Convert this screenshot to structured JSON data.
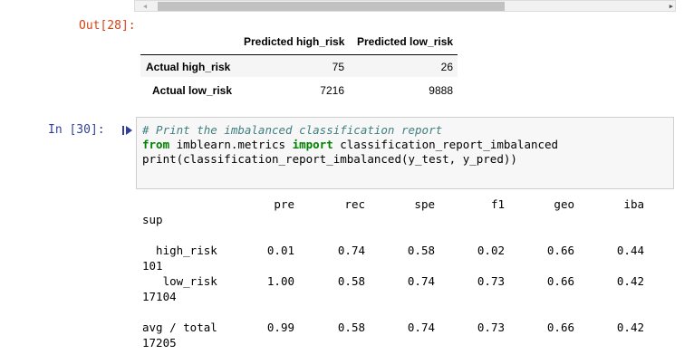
{
  "scrollbar": {
    "left_arrow": "◀",
    "right_arrow": "▶"
  },
  "out_prompt": "Out[28]:",
  "dataframe": {
    "columns": [
      "Predicted high_risk",
      "Predicted low_risk"
    ],
    "rows": [
      {
        "label": "Actual high_risk",
        "values": [
          "75",
          "26"
        ]
      },
      {
        "label": "Actual low_risk",
        "values": [
          "7216",
          "9888"
        ]
      }
    ]
  },
  "in_prompt": "In [30]:",
  "code": {
    "comment": "# Print the imbalanced classification report",
    "kw_from": "from",
    "module": " imblearn.metrics ",
    "kw_import": "import",
    "name": " classification_report_imbalanced",
    "line3": "print(classification_report_imbalanced(y_test, y_pred))"
  },
  "report": {
    "headers": [
      "pre",
      "rec",
      "spe",
      "f1",
      "geo",
      "iba"
    ],
    "sup": "sup",
    "rows": [
      {
        "label": "  high_risk",
        "values": [
          "0.01",
          "0.74",
          "0.58",
          "0.02",
          "0.66",
          "0.44"
        ],
        "support": "101"
      },
      {
        "label": "   low_risk",
        "values": [
          "1.00",
          "0.58",
          "0.74",
          "0.73",
          "0.66",
          "0.42"
        ],
        "support": "17104"
      },
      {
        "label": "avg / total",
        "values": [
          "0.99",
          "0.58",
          "0.74",
          "0.73",
          "0.66",
          "0.42"
        ],
        "support": "17205"
      }
    ]
  }
}
